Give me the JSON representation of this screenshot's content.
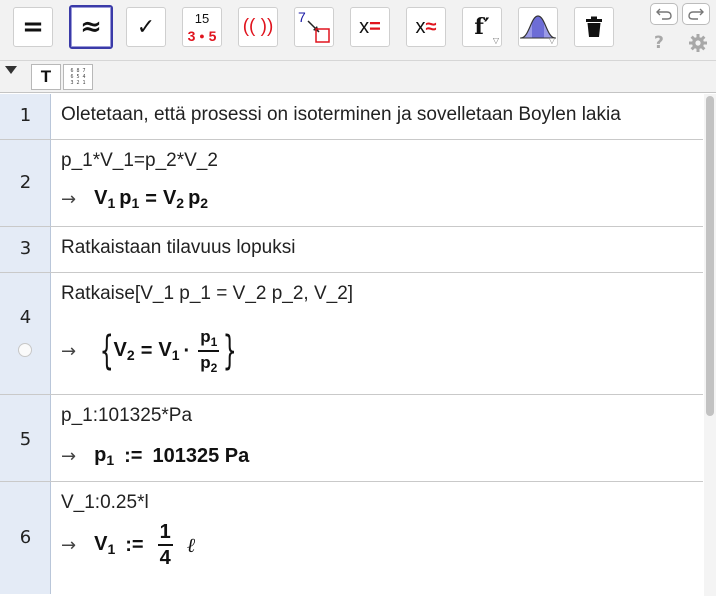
{
  "toolbar": {
    "tools": [
      {
        "name": "evaluate",
        "icon": "equals-icon",
        "label": "="
      },
      {
        "name": "numeric",
        "icon": "approx-icon",
        "label": "≈",
        "selected": true
      },
      {
        "name": "keep-input",
        "icon": "check-icon",
        "label": "✓"
      },
      {
        "name": "factor",
        "icon": "factor-icon",
        "top": "15",
        "bottom_left": "3",
        "bottom_right": "5"
      },
      {
        "name": "expand",
        "icon": "expand-icon",
        "label": "(( ))"
      },
      {
        "name": "substitute",
        "icon": "substitute-icon",
        "label": "7"
      },
      {
        "name": "solve",
        "icon": "solve-icon",
        "var": "x",
        "sym": "="
      },
      {
        "name": "solve-numerically",
        "icon": "solve-numerically-icon",
        "var": "x",
        "sym": "≈"
      },
      {
        "name": "derivative",
        "icon": "derivative-icon",
        "label": "f′"
      },
      {
        "name": "probability",
        "icon": "probability-icon"
      },
      {
        "name": "delete",
        "icon": "trash-icon"
      }
    ],
    "help_label": "?"
  },
  "stylebar": {
    "text_button_label": "T",
    "table_icon_lines": [
      "6 8 7",
      "6 5 4",
      "3 2 1"
    ]
  },
  "rows": [
    {
      "num": "1",
      "input": "Oletetaan, että prosessi on isoterminen ja sovelletaan Boylen lakia"
    },
    {
      "num": "2",
      "input": "p_1*V_1=p_2*V_2",
      "output_arrow": "→"
    },
    {
      "num": "3",
      "input": "Ratkaistaan tilavuus lopuksi"
    },
    {
      "num": "4",
      "input": "Ratkaise[V_1 p_1 = V_2 p_2, V_2]",
      "output_arrow": "→"
    },
    {
      "num": "5",
      "input": "p_1:101325*Pa",
      "output_arrow": "→",
      "output_value": "101325 Pa"
    },
    {
      "num": "6",
      "input": "V_1:0.25*l",
      "output_arrow": "→",
      "frac_num": "1",
      "frac_den": "4",
      "unit": "ℓ"
    }
  ],
  "colors": {
    "row_header_bg": "#e4ebf6",
    "selected_border": "#3a3aa8",
    "red": "#e0141e",
    "blue": "#1a1aa6",
    "probability_fill": "#9a9ae6"
  }
}
